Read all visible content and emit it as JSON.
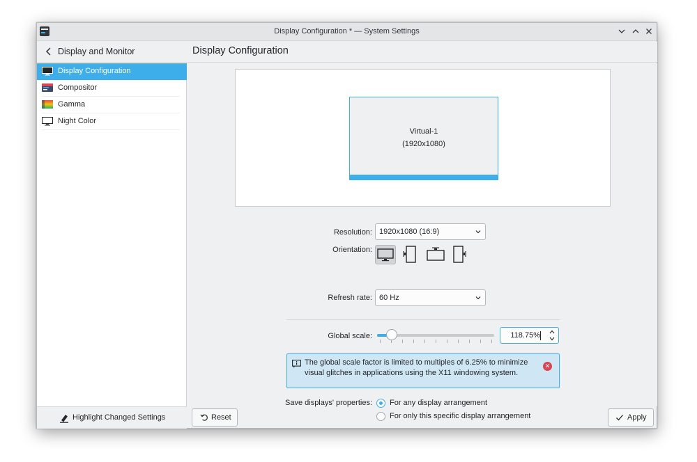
{
  "window": {
    "title": "Display Configuration * — System Settings",
    "controls": [
      "minimize",
      "maximize",
      "close"
    ]
  },
  "sidebar": {
    "header": "Display and Monitor",
    "items": [
      {
        "label": "Display Configuration",
        "icon": "monitor-icon",
        "active": true
      },
      {
        "label": "Compositor",
        "icon": "compositor-icon",
        "active": false
      },
      {
        "label": "Gamma",
        "icon": "gamma-icon",
        "active": false
      },
      {
        "label": "Night Color",
        "icon": "night-color-icon",
        "active": false
      }
    ],
    "footer_button": "Highlight Changed Settings"
  },
  "content": {
    "title": "Display Configuration",
    "preview": {
      "output_name": "Virtual-1",
      "output_resolution": "(1920x1080)"
    },
    "resolution": {
      "label": "Resolution:",
      "value": "1920x1080 (16:9)"
    },
    "orientation": {
      "label": "Orientation:",
      "options": [
        "landscape",
        "portrait-left",
        "landscape-flipped",
        "portrait-right"
      ],
      "selected": 0
    },
    "refresh_rate": {
      "label": "Refresh rate:",
      "value": "60 Hz"
    },
    "global_scale": {
      "label": "Global scale:",
      "value": "118.75%",
      "slider_fraction": 0.125,
      "tick_count": 11
    },
    "message": {
      "text": "The global scale factor is limited to multiples of 6.25% to minimize visual glitches in applications using the X11 windowing system."
    },
    "save_properties": {
      "label": "Save displays' properties:",
      "options": [
        {
          "label": "For any display arrangement",
          "checked": true
        },
        {
          "label": "For only this specific display arrangement",
          "checked": false
        }
      ]
    },
    "buttons": {
      "reset": "Reset",
      "apply": "Apply"
    }
  },
  "colors": {
    "accent": "#3daee9",
    "window_bg": "#eff0f1",
    "error": "#da4453"
  }
}
